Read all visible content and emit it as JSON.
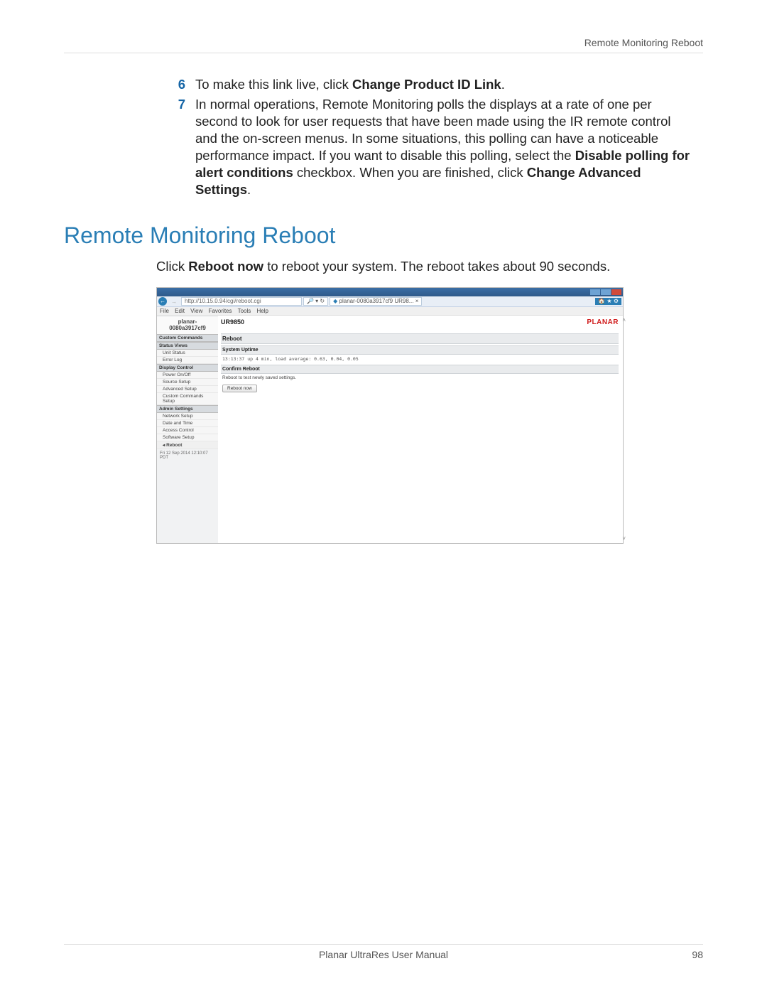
{
  "runningHead": "Remote Monitoring Reboot",
  "list": {
    "item6": {
      "num": "6",
      "pre": "To make this link live, click ",
      "b1": "Change Product ID Link",
      "post": "."
    },
    "item7": {
      "num": "7",
      "t1": "In normal operations, Remote Monitoring polls the displays at a rate of one per second to look for user requests that have been made using the IR remote control and the on-screen menus. In some situations, this polling can have a noticeable performance impact. If you want to disable this polling, select the ",
      "b1": "Disable polling for alert conditions",
      "t2": " checkbox. When you are finished, click ",
      "b2": "Change Advanced Settings",
      "t3": "."
    }
  },
  "sectionTitle": "Remote Monitoring Reboot",
  "para": {
    "t1": "Click ",
    "b1": "Reboot now",
    "t2": " to reboot your system. The reboot takes about 90 seconds."
  },
  "mock": {
    "url": "http://10.15.0.94/cgi/reboot.cgi",
    "tabLabel": "planar-0080a3917cf9 UR98...",
    "rightIcons": "🏠 ★ ⚙",
    "menu": {
      "file": "File",
      "edit": "Edit",
      "view": "View",
      "favorites": "Favorites",
      "tools": "Tools",
      "help": "Help"
    },
    "sidebar": {
      "title1": "planar-",
      "title2": "0080a3917cf9",
      "sec1": "Custom Commands",
      "sec2": "Status Views",
      "i_unit": "Unit Status",
      "i_err": "Error Log",
      "sec3": "Display Control",
      "i_pwr": "Power On/Off",
      "i_src": "Source Setup",
      "i_adv": "Advanced Setup",
      "i_cc": "Custom Commands Setup",
      "sec4": "Admin Settings",
      "i_net": "Network Setup",
      "i_dt": "Date and Time",
      "i_ac": "Access Control",
      "i_sw": "Software Setup",
      "i_reboot": "Reboot",
      "ts": "Fri 12 Sep 2014 12:10:07 PDT"
    },
    "main": {
      "model": "UR9850",
      "brand": "PLANAR",
      "barReboot": "Reboot",
      "barUptime": "System Uptime",
      "uptime": "13:13:37 up 4 min, load average: 0.63, 0.04, 0.05",
      "barConfirm": "Confirm Reboot",
      "confirmText": "Reboot to test newly saved settings.",
      "btn": "Reboot now"
    }
  },
  "footer": {
    "center": "Planar UltraRes User Manual",
    "page": "98"
  }
}
